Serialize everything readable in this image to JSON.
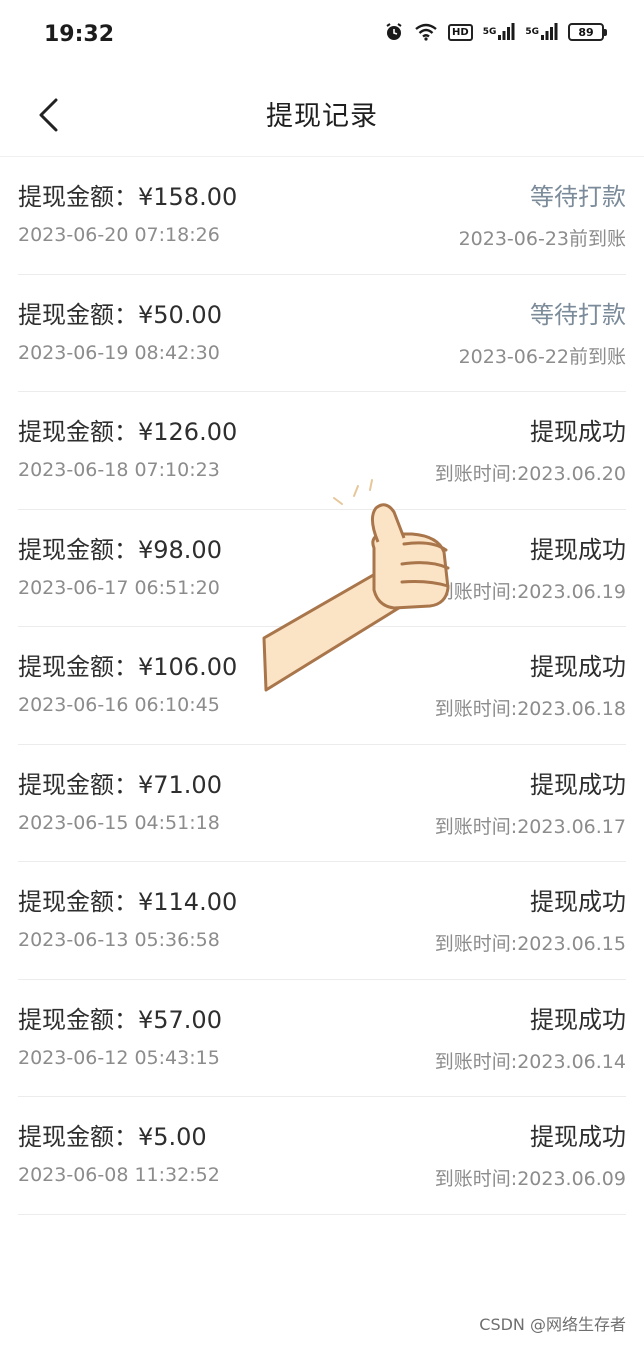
{
  "status_bar": {
    "time": "19:32",
    "network_1": "5G",
    "network_2": "5G",
    "hd_label": "HD",
    "battery": "89",
    "icons": [
      "alarm-icon",
      "wifi-icon",
      "hd-icon",
      "signal-icon",
      "signal-icon",
      "battery-icon"
    ]
  },
  "header": {
    "title": "提现记录",
    "back_icon": "chevron-left-icon"
  },
  "records": [
    {
      "amount": "提现金额：¥158.00",
      "date": "2023-06-20 07:18:26",
      "status": "等待打款",
      "arrival": "2023-06-23前到账",
      "pending": true
    },
    {
      "amount": "提现金额：¥50.00",
      "date": "2023-06-19 08:42:30",
      "status": "等待打款",
      "arrival": "2023-06-22前到账",
      "pending": true
    },
    {
      "amount": "提现金额：¥126.00",
      "date": "2023-06-18 07:10:23",
      "status": "提现成功",
      "arrival": "到账时间:2023.06.20",
      "pending": false
    },
    {
      "amount": "提现金额：¥98.00",
      "date": "2023-06-17 06:51:20",
      "status": "提现成功",
      "arrival": "到账时间:2023.06.19",
      "pending": false
    },
    {
      "amount": "提现金额：¥106.00",
      "date": "2023-06-16 06:10:45",
      "status": "提现成功",
      "arrival": "到账时间:2023.06.18",
      "pending": false
    },
    {
      "amount": "提现金额：¥71.00",
      "date": "2023-06-15 04:51:18",
      "status": "提现成功",
      "arrival": "到账时间:2023.06.17",
      "pending": false
    },
    {
      "amount": "提现金额：¥114.00",
      "date": "2023-06-13 05:36:58",
      "status": "提现成功",
      "arrival": "到账时间:2023.06.15",
      "pending": false
    },
    {
      "amount": "提现金额：¥57.00",
      "date": "2023-06-12 05:43:15",
      "status": "提现成功",
      "arrival": "到账时间:2023.06.14",
      "pending": false
    },
    {
      "amount": "提现金额：¥5.00",
      "date": "2023-06-08 11:32:52",
      "status": "提现成功",
      "arrival": "到账时间:2023.06.09",
      "pending": false
    }
  ],
  "overlay": {
    "icon": "thumbs-up-icon"
  },
  "watermark": "CSDN @网络生存者",
  "colors": {
    "pending_status": "#7b8b99",
    "success_status": "#2e2e2e",
    "secondary_text": "#8c8c8c"
  }
}
